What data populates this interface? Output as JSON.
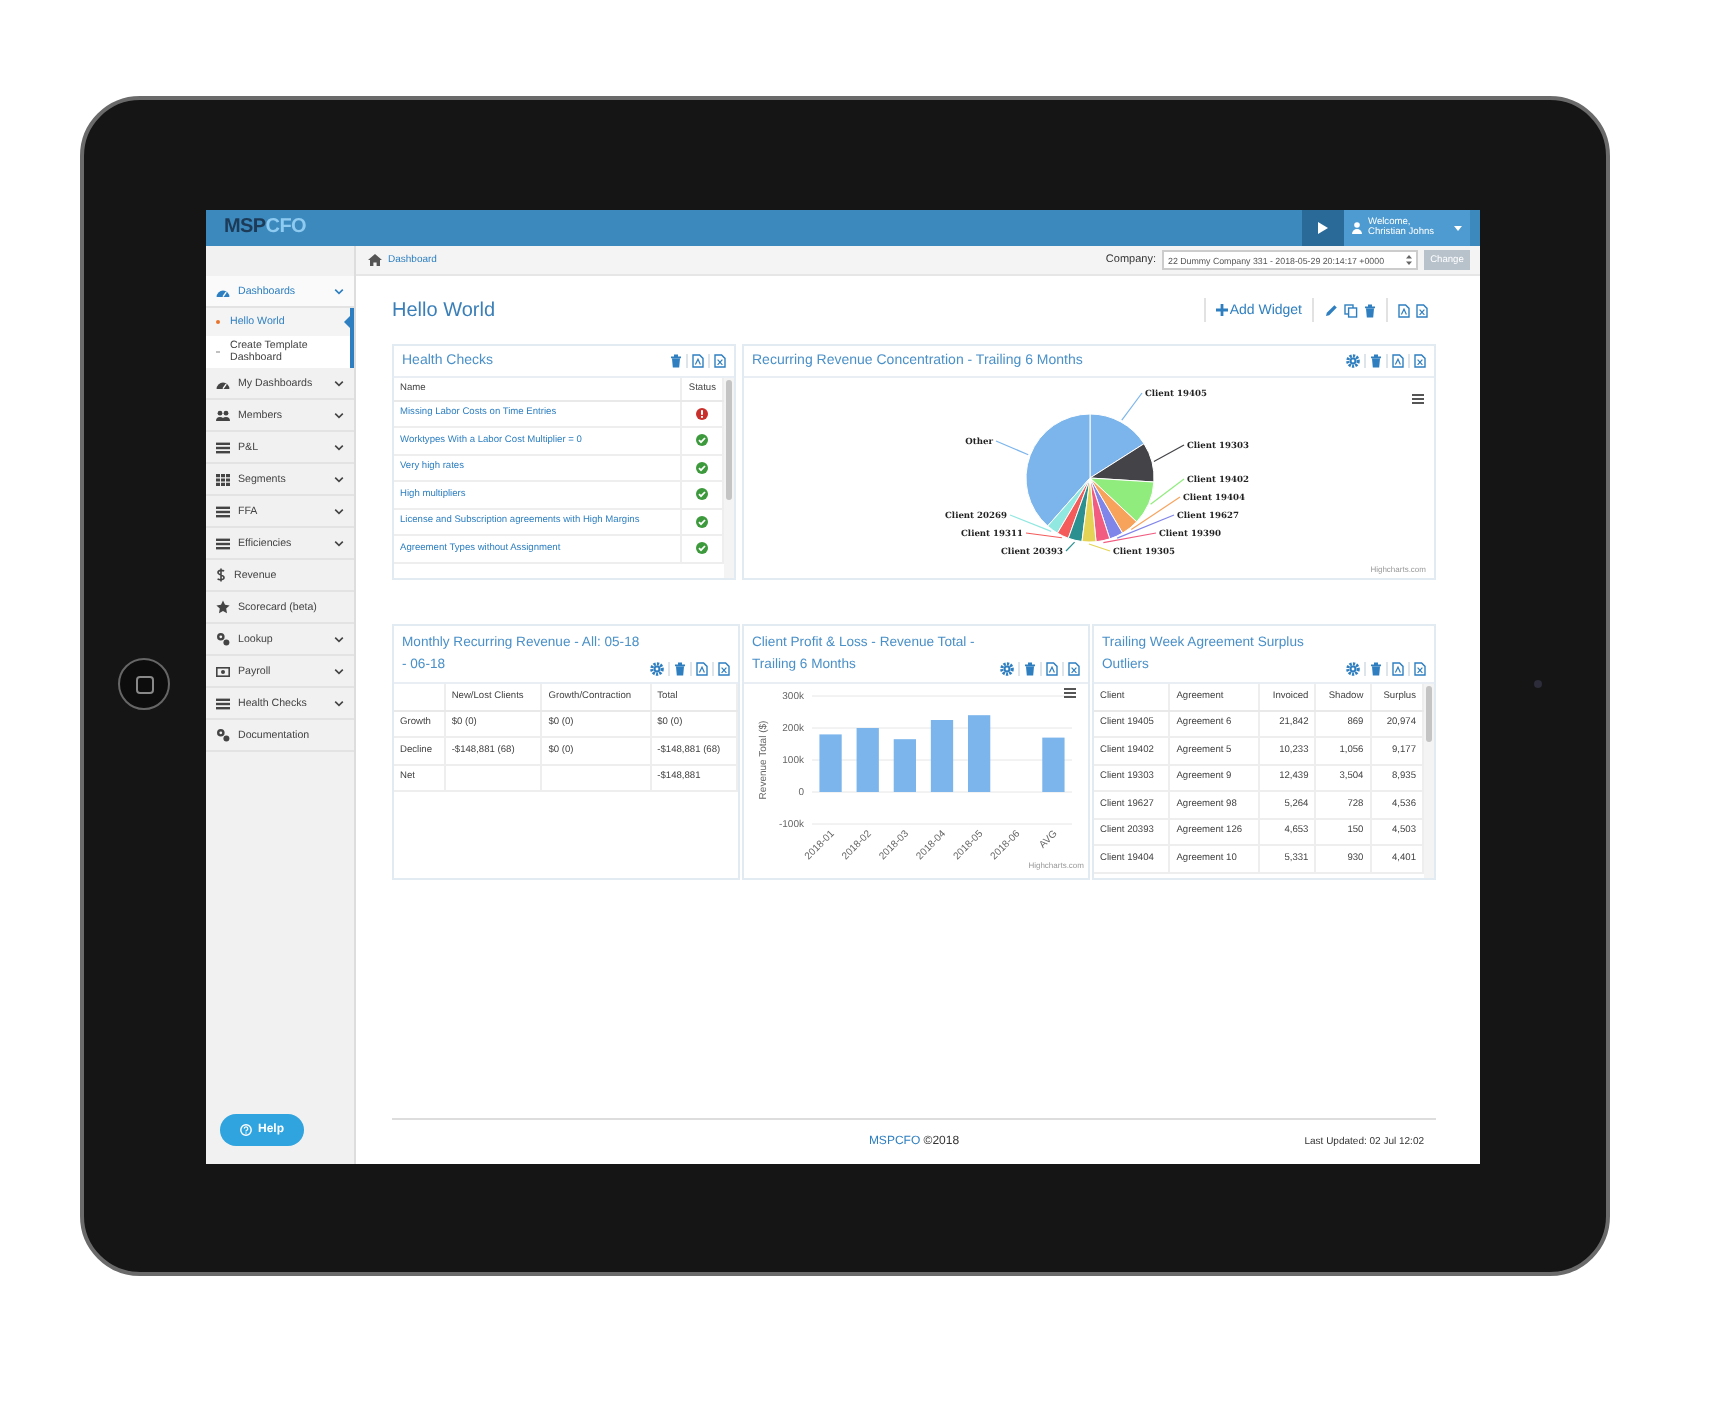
{
  "topbar": {
    "logo_dark": "MSP",
    "logo_light": "CFO",
    "welcome": "Welcome,",
    "user": "Christian Johns"
  },
  "sidebar": {
    "items": [
      {
        "label": "Dashboards",
        "expanded": true,
        "children": [
          {
            "label": "Hello World",
            "selected": true
          },
          {
            "label": "Create Template Dashboard",
            "selected": false
          }
        ]
      },
      {
        "label": "My Dashboards",
        "expanded": false
      },
      {
        "label": "Members",
        "expanded": false
      },
      {
        "label": "P&L",
        "expanded": false
      },
      {
        "label": "Segments",
        "expanded": false
      },
      {
        "label": "FFA",
        "expanded": false
      },
      {
        "label": "Efficiencies",
        "expanded": false
      },
      {
        "label": "Revenue"
      },
      {
        "label": "Scorecard (beta)"
      },
      {
        "label": "Lookup",
        "expanded": false
      },
      {
        "label": "Payroll",
        "expanded": false
      },
      {
        "label": "Health Checks",
        "expanded": false
      },
      {
        "label": "Documentation"
      }
    ],
    "help_button": "Help"
  },
  "breadcrumb": "Dashboard",
  "company": {
    "label": "Company:",
    "value": "22 Dummy Company 331 - 2018-05-29 20:14:17 +0000",
    "button": "Change"
  },
  "page_title": "Hello World",
  "add_widget": "Add Widget",
  "widgets": [
    {
      "kind": "health_checks",
      "title": "Health Checks",
      "has_settings": false,
      "columns": [
        "Name",
        "Status"
      ],
      "rows": [
        {
          "name": "Missing Labor Costs on Time Entries",
          "ok": false
        },
        {
          "name": "Worktypes With a Labor Cost Multiplier = 0",
          "ok": true
        },
        {
          "name": "Very high rates",
          "ok": true
        },
        {
          "name": "High multipliers",
          "ok": true
        },
        {
          "name": "License and Subscription agreements with High Margins",
          "ok": true
        },
        {
          "name": "Agreement Types without Assignment",
          "ok": true
        }
      ]
    },
    {
      "kind": "pie",
      "title": "Recurring Revenue Concentration - Trailing 6 Months",
      "has_settings": true,
      "credit": "Highcharts.com",
      "slices": [
        {
          "label": "Client 19405",
          "color": "#7cb5ec"
        },
        {
          "label": "Other",
          "color": "#7cb5ec"
        },
        {
          "label": "Client 19303",
          "color": "#434348"
        },
        {
          "label": "Client 19402",
          "color": "#90ed7d"
        },
        {
          "label": "Client 19404",
          "color": "#f7a35c"
        },
        {
          "label": "Client 20269",
          "color": "#91e8e1"
        },
        {
          "label": "Client 19627",
          "color": "#8085e9"
        },
        {
          "label": "Client 19311",
          "color": "#f45b5b"
        },
        {
          "label": "Client 19390",
          "color": "#f15c80"
        },
        {
          "label": "Client 20393",
          "color": "#2b908f"
        },
        {
          "label": "Client 19305",
          "color": "#e4d354"
        }
      ]
    },
    {
      "kind": "matrix",
      "title": "Monthly Recurring Revenue - All: 05-18 - 06-18",
      "has_settings": true,
      "columns": [
        "New/Lost Clients",
        "Growth/Contraction",
        "Total"
      ],
      "rows": [
        {
          "label": "Growth",
          "cells": [
            "$0 (0)",
            "$0 (0)",
            "$0 (0)"
          ]
        },
        {
          "label": "Decline",
          "cells": [
            "-$148,881 (68)",
            "$0 (0)",
            "-$148,881 (68)"
          ]
        },
        {
          "label": "Net",
          "cells": [
            null,
            null,
            "-$148,881"
          ]
        }
      ]
    },
    {
      "kind": "bar",
      "title": "Client Profit & Loss - Revenue Total - Trailing 6 Months",
      "has_settings": true,
      "credit": "Highcharts.com",
      "chart_data": {
        "type": "bar",
        "ylabel": "Revenue Total ($)",
        "categories": [
          "2018-01",
          "2018-02",
          "2018-03",
          "2018-04",
          "2018-05",
          "2018-06",
          "AVG"
        ],
        "values": [
          180000,
          200000,
          165000,
          225000,
          240000,
          null,
          170000
        ],
        "ylim": [
          -100000,
          300000
        ],
        "grid": true,
        "yticks": [
          {
            "value": -100000,
            "label": "-100k"
          },
          {
            "value": 0,
            "label": "0"
          },
          {
            "value": 100000,
            "label": "100k"
          },
          {
            "value": 200000,
            "label": "200k"
          },
          {
            "value": 300000,
            "label": "300k"
          }
        ]
      }
    },
    {
      "kind": "table",
      "title": "Trailing Week Agreement Surplus Outliers",
      "has_settings": true,
      "columns": [
        "Client",
        "Agreement",
        "Invoiced",
        "Shadow",
        "Surplus"
      ],
      "rows": [
        [
          "Client 19405",
          "Agreement 6",
          "21,842",
          "869",
          "20,974"
        ],
        [
          "Client 19402",
          "Agreement 5",
          "10,233",
          "1,056",
          "9,177"
        ],
        [
          "Client 19303",
          "Agreement 9",
          "12,439",
          "3,504",
          "8,935"
        ],
        [
          "Client 19627",
          "Agreement 98",
          "5,264",
          "728",
          "4,536"
        ],
        [
          "Client 20393",
          "Agreement 126",
          "4,653",
          "150",
          "4,503"
        ],
        [
          "Client 19404",
          "Agreement 10",
          "5,331",
          "930",
          "4,401"
        ]
      ]
    }
  ],
  "footer": {
    "brand": "MSPCFO",
    "copyright": "©2018",
    "updated": "Last Updated: 02 Jul 12:02"
  }
}
